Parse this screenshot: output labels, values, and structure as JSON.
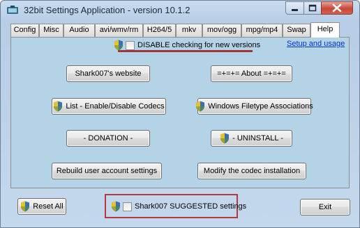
{
  "window": {
    "title": "32bit Settings Application - version 10.1.2",
    "icon": "app-icon",
    "controls": [
      "minimize-icon",
      "maximize-icon",
      "close-icon"
    ]
  },
  "tabs": [
    {
      "label": "Config",
      "active": false
    },
    {
      "label": "Misc",
      "active": false
    },
    {
      "label": "Audio",
      "active": false
    },
    {
      "label": "avi/wmv/rm",
      "active": false
    },
    {
      "label": "H264/5",
      "active": false
    },
    {
      "label": "mkv",
      "active": false
    },
    {
      "label": "mov/ogg",
      "active": false
    },
    {
      "label": "mpg/mp4",
      "active": false
    },
    {
      "label": "Swap",
      "active": false
    },
    {
      "label": "Help",
      "active": true
    }
  ],
  "help": {
    "disable_check_label": "DISABLE checking for new versions",
    "setup_link": "Setup and usage",
    "website_button": "Shark007's website",
    "about_button": "=+=+= About =+=+=",
    "codec_list_button": "List - Enable/Disable Codecs",
    "filetype_button": "Windows Filetype Associations",
    "donation_button": "- DONATION -",
    "uninstall_button": "- UNINSTALL -",
    "rebuild_button": "Rebuild user account settings",
    "modify_button": "Modify the codec installation"
  },
  "footer": {
    "reset_button": "Reset All",
    "suggested_label": "Shark007 SUGGESTED settings",
    "exit_button": "Exit"
  },
  "colors": {
    "panel_bg": "#b5d3e7",
    "highlight": "#b43a3a",
    "link": "#0033cc"
  }
}
